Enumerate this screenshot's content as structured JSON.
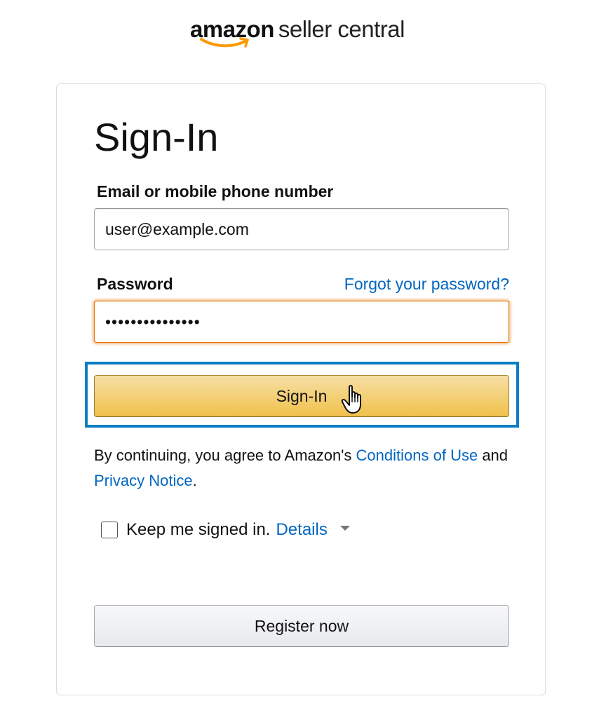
{
  "logo": {
    "brand": "amazon",
    "product": "seller central",
    "smile_color": "#FF9900"
  },
  "signin": {
    "title": "Sign-In",
    "email_label": "Email or mobile phone number",
    "email_value": "user@example.com",
    "password_label": "Password",
    "forgot_link": "Forgot your password?",
    "password_value": "•••••••••••••••",
    "submit_label": "Sign-In",
    "legal_prefix": "By continuing, you agree to Amazon's ",
    "conditions_link": "Conditions of Use",
    "legal_and": " and ",
    "privacy_link": "Privacy Notice",
    "legal_suffix": ".",
    "keep_signed_in_label": "Keep me signed in.",
    "keep_signed_in_checked": false,
    "details_link": "Details",
    "register_label": "Register now"
  },
  "colors": {
    "link": "#0066C0",
    "button_primary_top": "#F7DFA5",
    "button_primary_bottom": "#F0C14B",
    "focus_ring": "#0A7EC4",
    "input_focus": "#E77600"
  },
  "cursor": "hand-pointer-icon"
}
